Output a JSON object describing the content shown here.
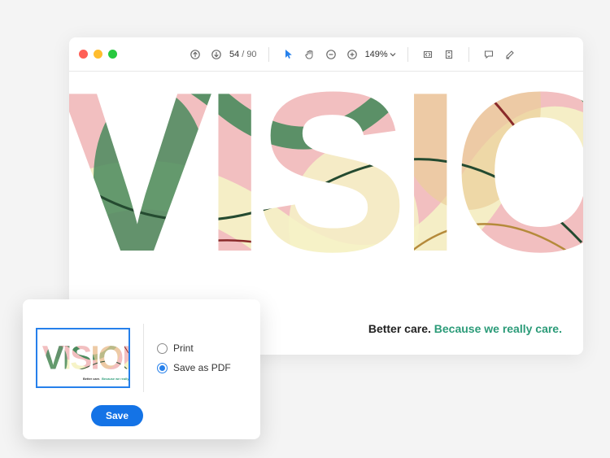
{
  "toolbar": {
    "page_current": "54",
    "page_sep": "/",
    "page_total": "90",
    "zoom_label": "149%"
  },
  "document": {
    "headline_text": "VISION",
    "tagline_lead": "Better care. ",
    "tagline_accent": "Because we really care."
  },
  "dialog": {
    "options": {
      "print": "Print",
      "save_pdf": "Save as PDF"
    },
    "selected": "save_pdf",
    "save_label": "Save"
  },
  "colors": {
    "accent_green": "#2b9b78",
    "primary_blue": "#1473e6",
    "selection_blue": "#2680eb"
  }
}
